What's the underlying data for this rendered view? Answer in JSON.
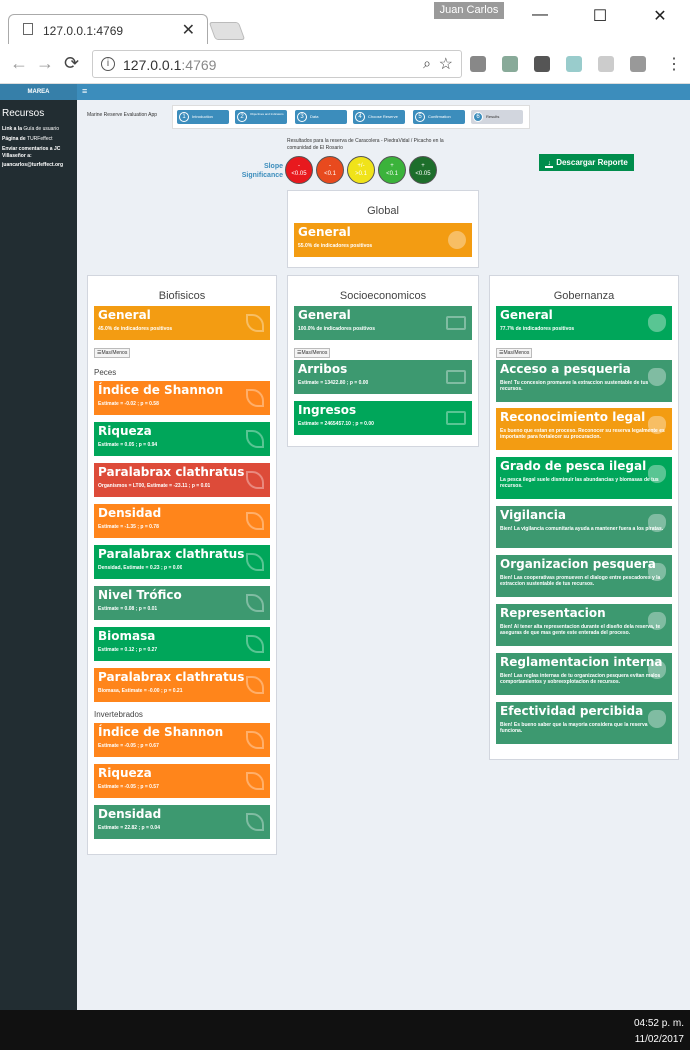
{
  "browser": {
    "tab_title": "127.0.0.1:4769",
    "user": "Juan Carlos",
    "url_host": "127.0.0.1",
    "url_port": ":4769",
    "tab_close": "✕",
    "minimize": "—",
    "maximize": "☐",
    "close": "✕"
  },
  "app": {
    "logo": "MAREA",
    "title": "Marine Reserve Evaluation App",
    "steps": [
      {
        "num": "1",
        "label": "Introduction"
      },
      {
        "num": "2",
        "label": "Objectives and Indicators"
      },
      {
        "num": "3",
        "label": "Data"
      },
      {
        "num": "4",
        "label": "Choose Reserve"
      },
      {
        "num": "5",
        "label": "Confirmation"
      },
      {
        "num": "6",
        "label": "Results"
      }
    ],
    "results_text": "Resultados para la reserva de Caracolera - PiedraVidal / Picacho en la comunidad de El Rosario",
    "slope_label": "Slope Significance",
    "circles": [
      {
        "sym": "-",
        "val": "<0.05",
        "color": "#e8191e"
      },
      {
        "sym": "-",
        "val": "<0.1",
        "color": "#e84a1e"
      },
      {
        "sym": "+/-",
        "val": ">0.1",
        "color": "#f0e31a"
      },
      {
        "sym": "+",
        "val": "<0.1",
        "color": "#3bb33b"
      },
      {
        "sym": "+",
        "val": "<0.05",
        "color": "#1d6e2b"
      }
    ],
    "download_label": "Descargar Reporte"
  },
  "sidebar": {
    "title": "Recursos",
    "link_label": "Link a la",
    "link_value": "Guía de usuario",
    "page_label": "Página de",
    "page_value": "TURFeffect",
    "send_label": "Enviar comentarios a JC Villaseñor a:",
    "email": "juancarlos@turfeffect.org"
  },
  "global": {
    "title": "Global",
    "general_title": "General",
    "general_desc": "55.0% de indicadores positivos"
  },
  "bio": {
    "title": "Biofisicos",
    "general_title": "General",
    "general_desc": "45.0% de indicadores positivos",
    "masmenos": "Mas/Menos",
    "fish_head": "Peces",
    "inv_head": "Invertebrados",
    "fish": [
      {
        "title": "Índice de Shannon",
        "desc": "Estimate = -0.02 ; p = 0.58"
      },
      {
        "title": "Riqueza",
        "desc": "Estimate = 0.05 ; p = 0.94"
      },
      {
        "title": "Paralabrax clathratus",
        "desc": "Organismos = LT00, Estimate = -23.11 ; p = 0.01"
      },
      {
        "title": "Densidad",
        "desc": "Estimate = -1.35 ; p = 0.78"
      },
      {
        "title": "Paralabrax clathratus",
        "desc": "Densidad, Estimate = 0.23 ; p = 0.00"
      },
      {
        "title": "Nivel Trófico",
        "desc": "Estimate = 0.08 ; p = 0.01"
      },
      {
        "title": "Biomasa",
        "desc": "Estimate = 0.12 ; p = 0.27"
      },
      {
        "title": "Paralabrax clathratus",
        "desc": "Biomasa, Estimate = -0.00 ; p = 0.21"
      }
    ],
    "inv": [
      {
        "title": "Índice de Shannon",
        "desc": "Estimate = -0.05 ; p = 0.67"
      },
      {
        "title": "Riqueza",
        "desc": "Estimate = -0.05 ; p = 0.57"
      },
      {
        "title": "Densidad",
        "desc": "Estimate = 22.82 ; p = 0.04"
      }
    ]
  },
  "socio": {
    "title": "Socioeconomicos",
    "general_title": "General",
    "general_desc": "100.0% de indicadores positivos",
    "masmenos": "Mas/Menos",
    "items": [
      {
        "title": "Arribos",
        "desc": "Estimate = 13422.80 ; p = 0.00"
      },
      {
        "title": "Ingresos",
        "desc": "Estimate = 2465457.10 ; p = 0.00"
      }
    ]
  },
  "gob": {
    "title": "Gobernanza",
    "general_title": "General",
    "general_desc": "77.7% de indicadores positivos",
    "masmenos": "Mas/Menos",
    "items": [
      {
        "title": "Acceso a pesqueria",
        "desc": "Bien! Tu concesion promueve la extraccion sustentable de tus recursos."
      },
      {
        "title": "Reconocimiento legal",
        "desc": "Es bueno que estan en proceso. Reconocer su reserva legalmente es importante para fortalecer su procuracion."
      },
      {
        "title": "Grado de pesca ilegal",
        "desc": "La pesca ilegal suele disminuir las abundancias y biomasas de tus recursos."
      },
      {
        "title": "Vigilancia",
        "desc": "Bien! La vigilancia comunitaria ayuda a mantener fuera a los piratas."
      },
      {
        "title": "Organizacion pesquera",
        "desc": "Bien! Las cooperativas promueven el dialogo entre pescadores y la extraccion sustentable de tus recursos."
      },
      {
        "title": "Representacion",
        "desc": "Bien! Al tener alta representacion durante el diseño dela reserva, te aseguras de que mas gente este enterada del proceso."
      },
      {
        "title": "Reglamentacion interna",
        "desc": "Bien! Las reglas internas de tu organizacion pesquera evitan malos comportamientos y sobreexplotacion de recursos."
      },
      {
        "title": "Efectividad percibida",
        "desc": "Bien! Es bueno saber que la mayoria considera que la reserva funciona."
      }
    ]
  },
  "taskbar": {
    "time": "04:52 p. m.",
    "date": "11/02/2017"
  },
  "colors": {
    "orange": "#f39c12",
    "orange_bright": "#ff851b",
    "green": "#00a65a",
    "olive": "#3d9970",
    "red": "#dd4b39",
    "header_blue": "#3c8dbc",
    "sidebar_dark": "#222d32"
  },
  "icons": [
    "leaf-icon",
    "money-icon",
    "globe-icon",
    "paw-icon",
    "download-icon",
    "list-icon"
  ]
}
